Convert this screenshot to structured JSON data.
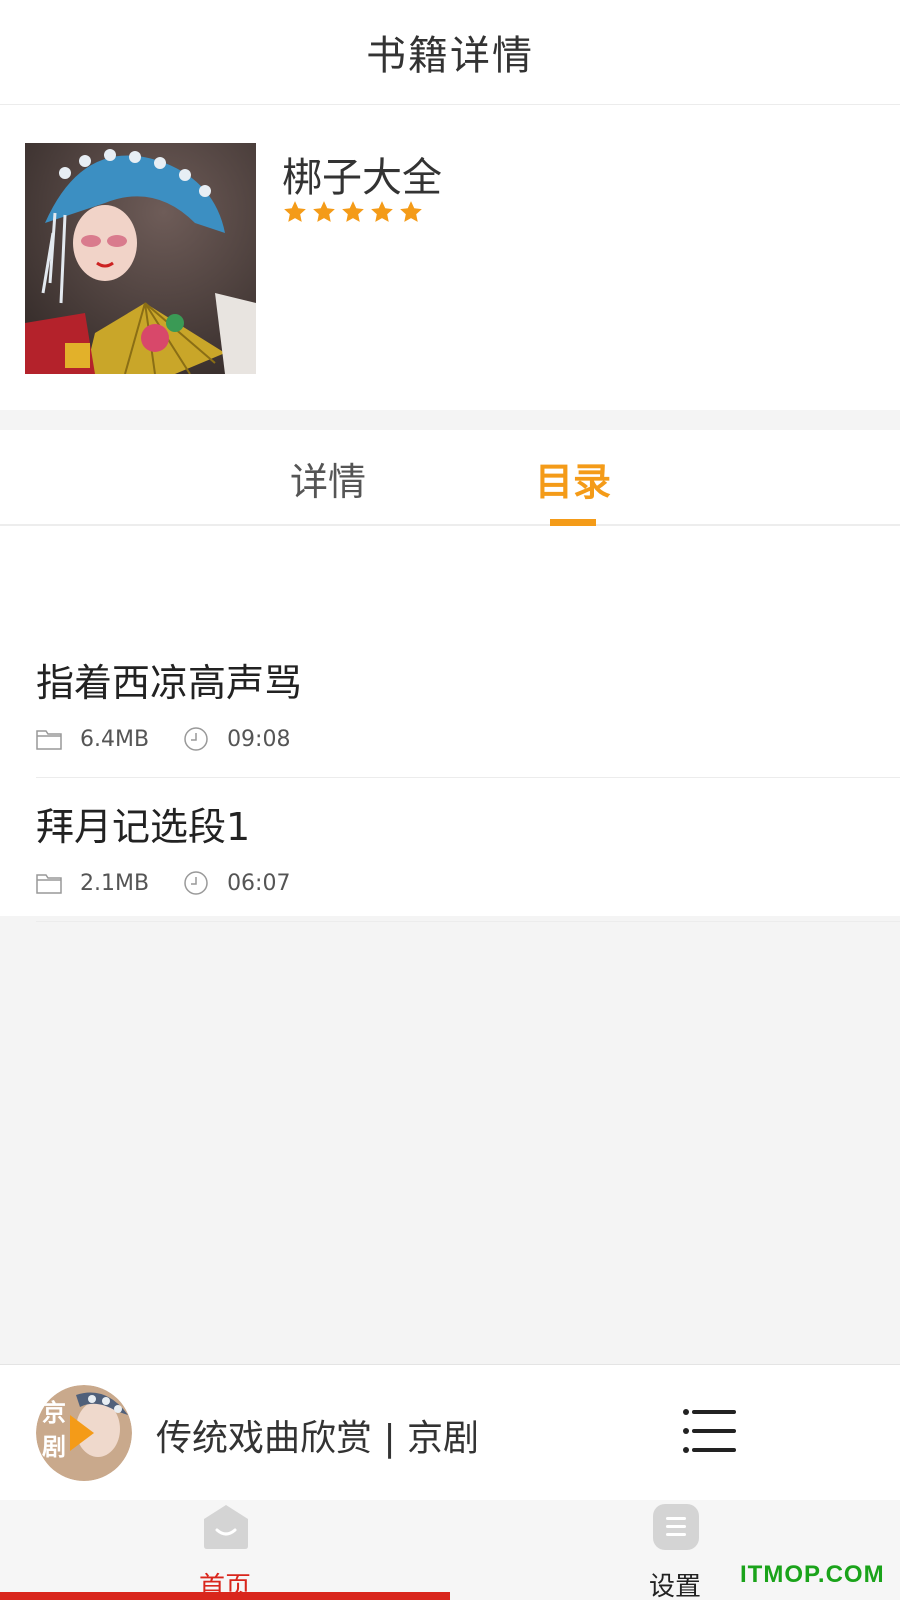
{
  "header": {
    "title": "书籍详情"
  },
  "book": {
    "name": "梆子大全",
    "rating": 5,
    "cover_icon": "opera-performer-with-fan-image"
  },
  "tabs": [
    {
      "label": "详情",
      "active": false
    },
    {
      "label": "目录",
      "active": true
    }
  ],
  "tracks": [
    {
      "title": "指着西凉高声骂",
      "size": "6.4MB",
      "duration": "09:08"
    },
    {
      "title": "拜月记选段1",
      "size": "2.1MB",
      "duration": "06:07"
    }
  ],
  "player": {
    "title": "传统戏曲欣赏 | 京剧",
    "avatar_text": "京剧",
    "playlist_icon": "menu-list-icon"
  },
  "tabbar": [
    {
      "label": "首页",
      "icon": "home-icon",
      "active": true
    },
    {
      "label": "设置",
      "icon": "settings-icon",
      "active": false
    }
  ],
  "watermark": "ITMOP.COM",
  "colors": {
    "accent": "#f49b18",
    "active_red": "#d9261c",
    "watermark_green": "#1aa31a"
  }
}
